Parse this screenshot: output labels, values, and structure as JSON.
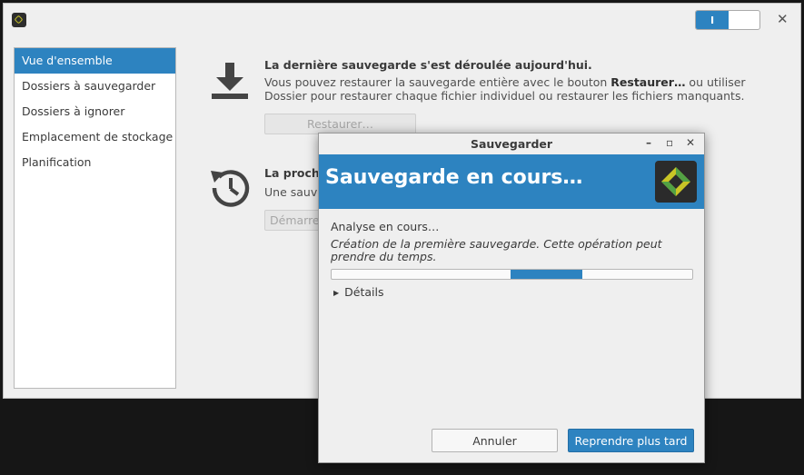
{
  "main": {
    "switch_label": "I",
    "close_glyph": "✕"
  },
  "sidebar": {
    "items": [
      {
        "label": "Vue d'ensemble"
      },
      {
        "label": "Dossiers à sauvegarder"
      },
      {
        "label": "Dossiers à ignorer"
      },
      {
        "label": "Emplacement de stockage"
      },
      {
        "label": "Planification"
      }
    ]
  },
  "overview": {
    "restore": {
      "title": "La dernière sauvegarde s'est déroulée aujourd'hui.",
      "line1_pre": "Vous pouvez restaurer la sauvegarde entière avec le bouton ",
      "line1_bold": "Restaurer…",
      "line1_post": " ou utiliser",
      "line2": "Dossier pour restaurer chaque fichier individuel ou restaurer les fichiers manquants.",
      "button": "Restaurer…"
    },
    "next": {
      "title": "La proch",
      "text": "Une sauve",
      "button": "Démarrer"
    }
  },
  "dialog": {
    "title": "Sauvegarder",
    "min_glyph": "–",
    "max_glyph": "▫",
    "close_glyph": "✕",
    "header_title": "Sauvegarde en cours…",
    "status": "Analyse en cours…",
    "description_line1": "Création de la première sauvegarde. Cette opération peut",
    "description_line2": "prendre du temps.",
    "details": "Détails",
    "cancel_button": "Annuler",
    "later_button": "Reprendre plus tard"
  },
  "colors": {
    "accent": "#2d83c0",
    "logo_yellow": "#c9c526",
    "logo_green": "#52a244"
  },
  "icons": {
    "restore": "download-icon",
    "schedule": "history-clock-icon",
    "app": "deja-dup-icon"
  }
}
